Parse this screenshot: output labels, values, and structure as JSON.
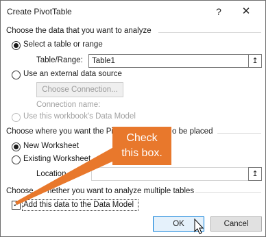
{
  "window": {
    "title": "Create PivotTable",
    "help_glyph": "?",
    "close_glyph": "✕"
  },
  "section1": {
    "heading": "Choose the data that you want to analyze",
    "select_table_label": "Select a table or range",
    "table_range_label": "Table/Range:",
    "table_range_value": "Table1",
    "external_source_label": "Use an external data source",
    "choose_connection_label": "Choose Connection...",
    "connection_name_label": "Connection name:",
    "data_model_label": "Use this workbook's Data Model"
  },
  "section2": {
    "heading_part1": "Choose where you want the Pi",
    "heading_part2": "o be placed",
    "new_worksheet_label": "New Worksheet",
    "existing_worksheet_label": "Existing Worksheet",
    "location_label": "Location",
    "location_value": ""
  },
  "section3": {
    "heading_part1": "Choose ",
    "heading_part2": "hether you want to analyze multiple tables",
    "add_to_data_model_label": "Add this data to the Data Model",
    "add_to_data_model_checked": "✓"
  },
  "buttons": {
    "ok_label": "OK",
    "cancel_label": "Cancel"
  },
  "callout": {
    "line1": "Check",
    "line2": "this box."
  },
  "icons": {
    "collapse_glyph": "↥"
  },
  "colors": {
    "callout": "#e8782c",
    "default_button_border": "#0078d7"
  }
}
